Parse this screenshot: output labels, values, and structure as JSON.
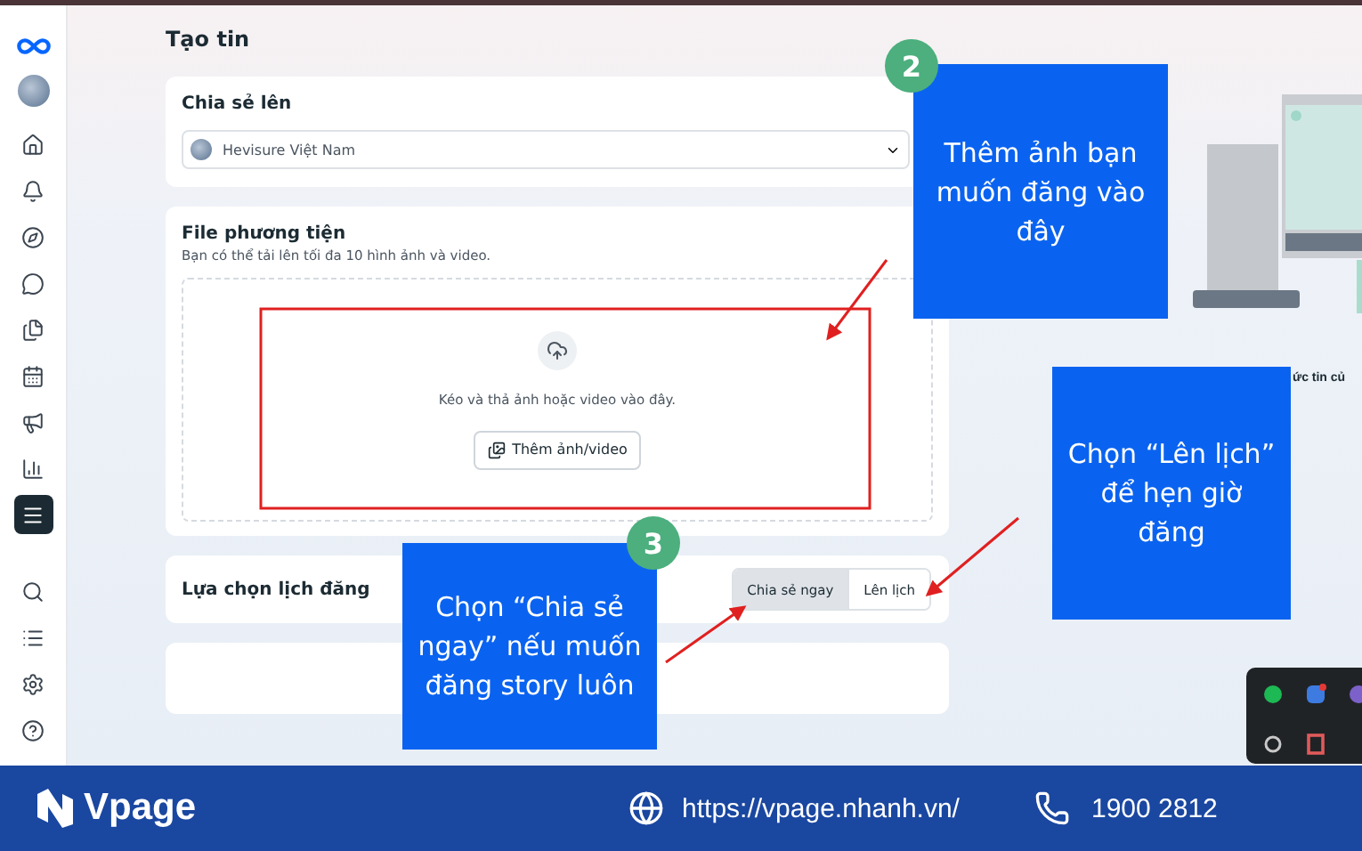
{
  "nav": [
    {
      "selected": false
    },
    {
      "selected": false
    },
    {
      "selected": false
    },
    {
      "selected": false
    },
    {
      "selected": false
    },
    {
      "selected": false
    },
    {
      "selected": false
    },
    {
      "selected": false
    },
    {
      "selected": true
    },
    {
      "selected": false
    },
    {
      "selected": false
    },
    {
      "selected": false
    },
    {
      "selected": false
    }
  ],
  "page_title": "Tạo tin",
  "share_to": {
    "label": "Chia sẻ lên",
    "account": "Hevisure Việt Nam"
  },
  "media": {
    "title": "File phương tiện",
    "hint": "Bạn có thể tải lên tối đa 10 hình ảnh và video.",
    "drop_text": "Kéo và thả ảnh hoặc video vào đây.",
    "add_button": "Thêm ảnh/video"
  },
  "schedule": {
    "label": "Lựa chọn lịch đăng",
    "options": [
      {
        "label": "Chia sẻ ngay",
        "selected": true
      },
      {
        "label": "Lên lịch",
        "selected": false
      }
    ]
  },
  "preview_caption": "ức tin củ",
  "annotations": [
    {
      "badge": "2",
      "text": "Thêm ảnh bạn muốn đăng vào đây"
    },
    {
      "badge": "3",
      "text": "Chọn “Chia sẻ ngay” nếu muốn đăng story luôn"
    },
    {
      "text": "Chọn “Lên lịch” để hẹn giờ đăng"
    }
  ],
  "footer": {
    "brand": "Vpage",
    "url": "https://vpage.nhanh.vn/",
    "phone": "1900 2812"
  }
}
